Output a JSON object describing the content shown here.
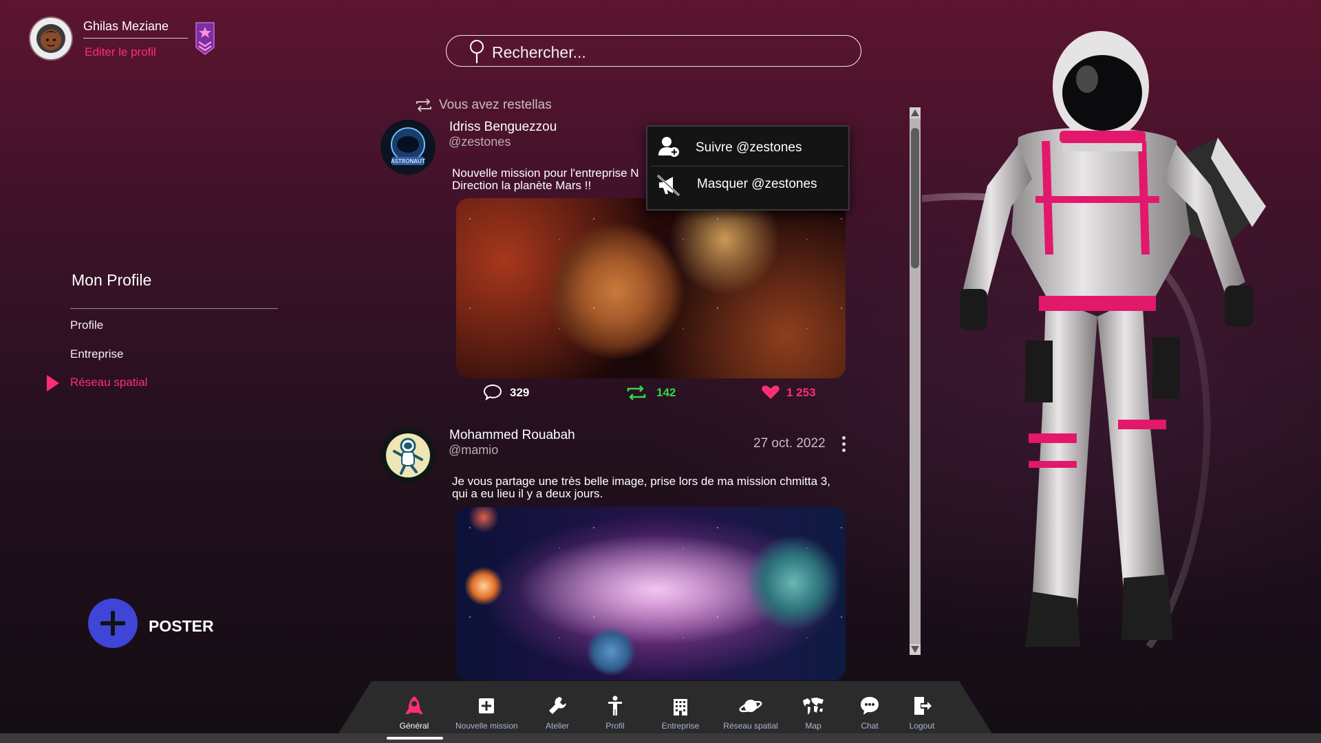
{
  "user": {
    "name": "Ghilas Meziane",
    "edit_profile": "Editer le profil"
  },
  "search": {
    "placeholder": "Rechercher..."
  },
  "menu": {
    "title": "Mon Profile",
    "items": [
      {
        "label": "Profile",
        "active": false
      },
      {
        "label": "Entreprise",
        "active": false
      },
      {
        "label": "Réseau spatial",
        "active": true
      }
    ]
  },
  "poster": {
    "label": "POSTER"
  },
  "feed": {
    "restella_label": "Vous avez restellas",
    "posts": [
      {
        "author": "Idriss Benguezzou",
        "handle": "@zestones",
        "text_line1": "Nouvelle mission pour l'entreprise N",
        "text_line1_tail": "!",
        "text_line2": "Direction la planète Mars !!",
        "comments": "329",
        "restellas": "142",
        "likes": "1 253"
      },
      {
        "author": "Mohammed Rouabah",
        "handle": "@mamio",
        "date": "27 oct. 2022",
        "text_line1": "Je vous partage une très belle image, prise lors de ma mission chmitta 3,",
        "text_line2": "qui a eu lieu il y a deux jours."
      }
    ]
  },
  "context_menu": {
    "follow": "Suivre @zestones",
    "mute": "Masquer @zestones"
  },
  "nav": {
    "items": [
      {
        "label": "Général",
        "icon": "rocket-icon",
        "active": true
      },
      {
        "label": "Nouvelle mission",
        "icon": "plus-square-icon",
        "active": false
      },
      {
        "label": "Atelier",
        "icon": "wrench-icon",
        "active": false
      },
      {
        "label": "Profil",
        "icon": "person-icon",
        "active": false
      },
      {
        "label": "Entreprise",
        "icon": "building-icon",
        "active": false
      },
      {
        "label": "Réseau spatial",
        "icon": "planet-icon",
        "active": false
      },
      {
        "label": "Map",
        "icon": "world-map-icon",
        "active": false
      },
      {
        "label": "Chat",
        "icon": "chat-bubble-icon",
        "active": false
      },
      {
        "label": "Logout",
        "icon": "logout-icon",
        "active": false
      }
    ]
  },
  "colors": {
    "accent_pink": "#ff2e73",
    "poster_blue": "#3f45d6",
    "restella_green": "#35d64a",
    "nav_label": "#a8b6d6"
  }
}
